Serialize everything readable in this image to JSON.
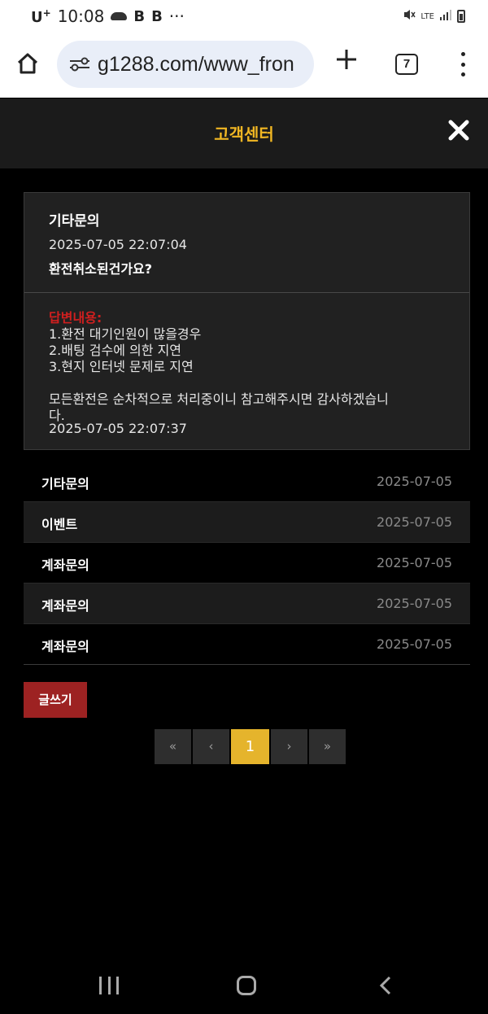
{
  "status_bar": {
    "carrier": "U",
    "carrier_sup": "+",
    "time": "10:08",
    "icons": [
      "cloud-icon",
      "b-icon",
      "b-icon",
      "more-dots"
    ],
    "b_glyph": "B",
    "dots": "···",
    "network": "LTE"
  },
  "browser": {
    "url": "g1288.com/www_fron",
    "tab_count": "7"
  },
  "header": {
    "title": "고객센터"
  },
  "detail": {
    "category": "기타문의",
    "date": "2025-07-05 22:07:04",
    "question": "환전취소된건가요?",
    "answer_label": "답변내용:",
    "answer_lines": [
      "1.환전 대기인원이 많을경우",
      "2.배팅 검수에 의한 지연",
      "3.현지 인터넷 문제로 지연",
      "",
      "모든환전은 순차적으로 처리중이니 참고해주시면 감사하겠습니",
      "다."
    ],
    "answer_date": "2025-07-05 22:07:37"
  },
  "list": [
    {
      "category": "기타문의",
      "date": "2025-07-05"
    },
    {
      "category": "이벤트",
      "date": "2025-07-05"
    },
    {
      "category": "계좌문의",
      "date": "2025-07-05"
    },
    {
      "category": "계좌문의",
      "date": "2025-07-05"
    },
    {
      "category": "계좌문의",
      "date": "2025-07-05"
    }
  ],
  "write_label": "글쓰기",
  "pagination": {
    "first": "«",
    "prev": "‹",
    "current": "1",
    "next": "›",
    "last": "»"
  },
  "colors": {
    "accent": "#f0b623",
    "answer_label": "#d01f1f",
    "write_button": "#9d2222",
    "active_page": "#e5b42c"
  }
}
